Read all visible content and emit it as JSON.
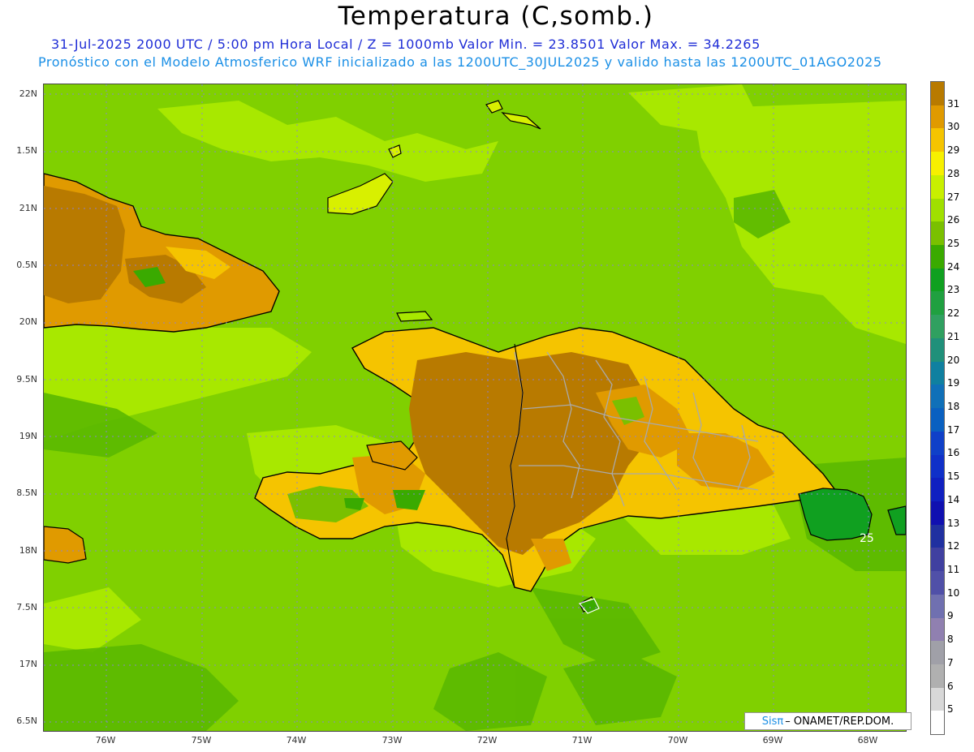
{
  "header": {
    "title": "Temperatura (C,somb.)",
    "subtitle_line1": "31-Jul-2025  2000 UTC / 5:00 pm Hora Local / Z = 1000mb   Valor Min. = 23.8501  Valor Max. = 34.2265",
    "subtitle_line2": "Pronóstico con el Modelo Atmosferico WRF inicializado a las 1200UTC_30JUL2025 y valido hasta las  1200UTC_01AGO2025"
  },
  "axes": {
    "lat_labels": [
      "22N",
      "1.5N",
      "21N",
      "0.5N",
      "20N",
      "9.5N",
      "19N",
      "8.5N",
      "18N",
      "7.5N",
      "17N",
      "6.5N"
    ],
    "lon_labels": [
      "76W",
      "75W",
      "74W",
      "73W",
      "72W",
      "71W",
      "70W",
      "69W",
      "68W"
    ]
  },
  "colorbar": {
    "labels": [
      "31",
      "30",
      "29",
      "28",
      "27",
      "26",
      "25",
      "24",
      "23",
      "22",
      "21",
      "20",
      "19",
      "18",
      "17",
      "16",
      "15",
      "14",
      "13",
      "12",
      "11",
      "10",
      "9",
      "8",
      "7",
      "6",
      "5"
    ],
    "colors": [
      "#b87a00",
      "#e09a00",
      "#f5c400",
      "#f7f000",
      "#c8f000",
      "#a0e000",
      "#7ac000",
      "#3aaa00",
      "#10a020",
      "#20a040",
      "#30a060",
      "#20907a",
      "#1080a0",
      "#1070b8",
      "#0a60c0",
      "#1040c8",
      "#1030c8",
      "#1020c0",
      "#1010b0",
      "#2030a0",
      "#4040a0",
      "#5050a8",
      "#7070b0",
      "#9080b0",
      "#a0a0a8",
      "#b0b0b0",
      "#d8d8d8",
      "#ffffff"
    ]
  },
  "map": {
    "colors": {
      "sea": "#80d000",
      "warm_sea": "#a8e800",
      "land_hot": "#b87a00",
      "land_warm": "#e09a00",
      "land_mild": "#f5c400",
      "land_yellow": "#f7f000",
      "cool_green": "#3aaa00",
      "cold_patch": "#10a020"
    },
    "contour_label": "25"
  },
  "logo": {
    "sis": "Sisπ",
    "org": "– ONAMET/REP.DOM."
  }
}
